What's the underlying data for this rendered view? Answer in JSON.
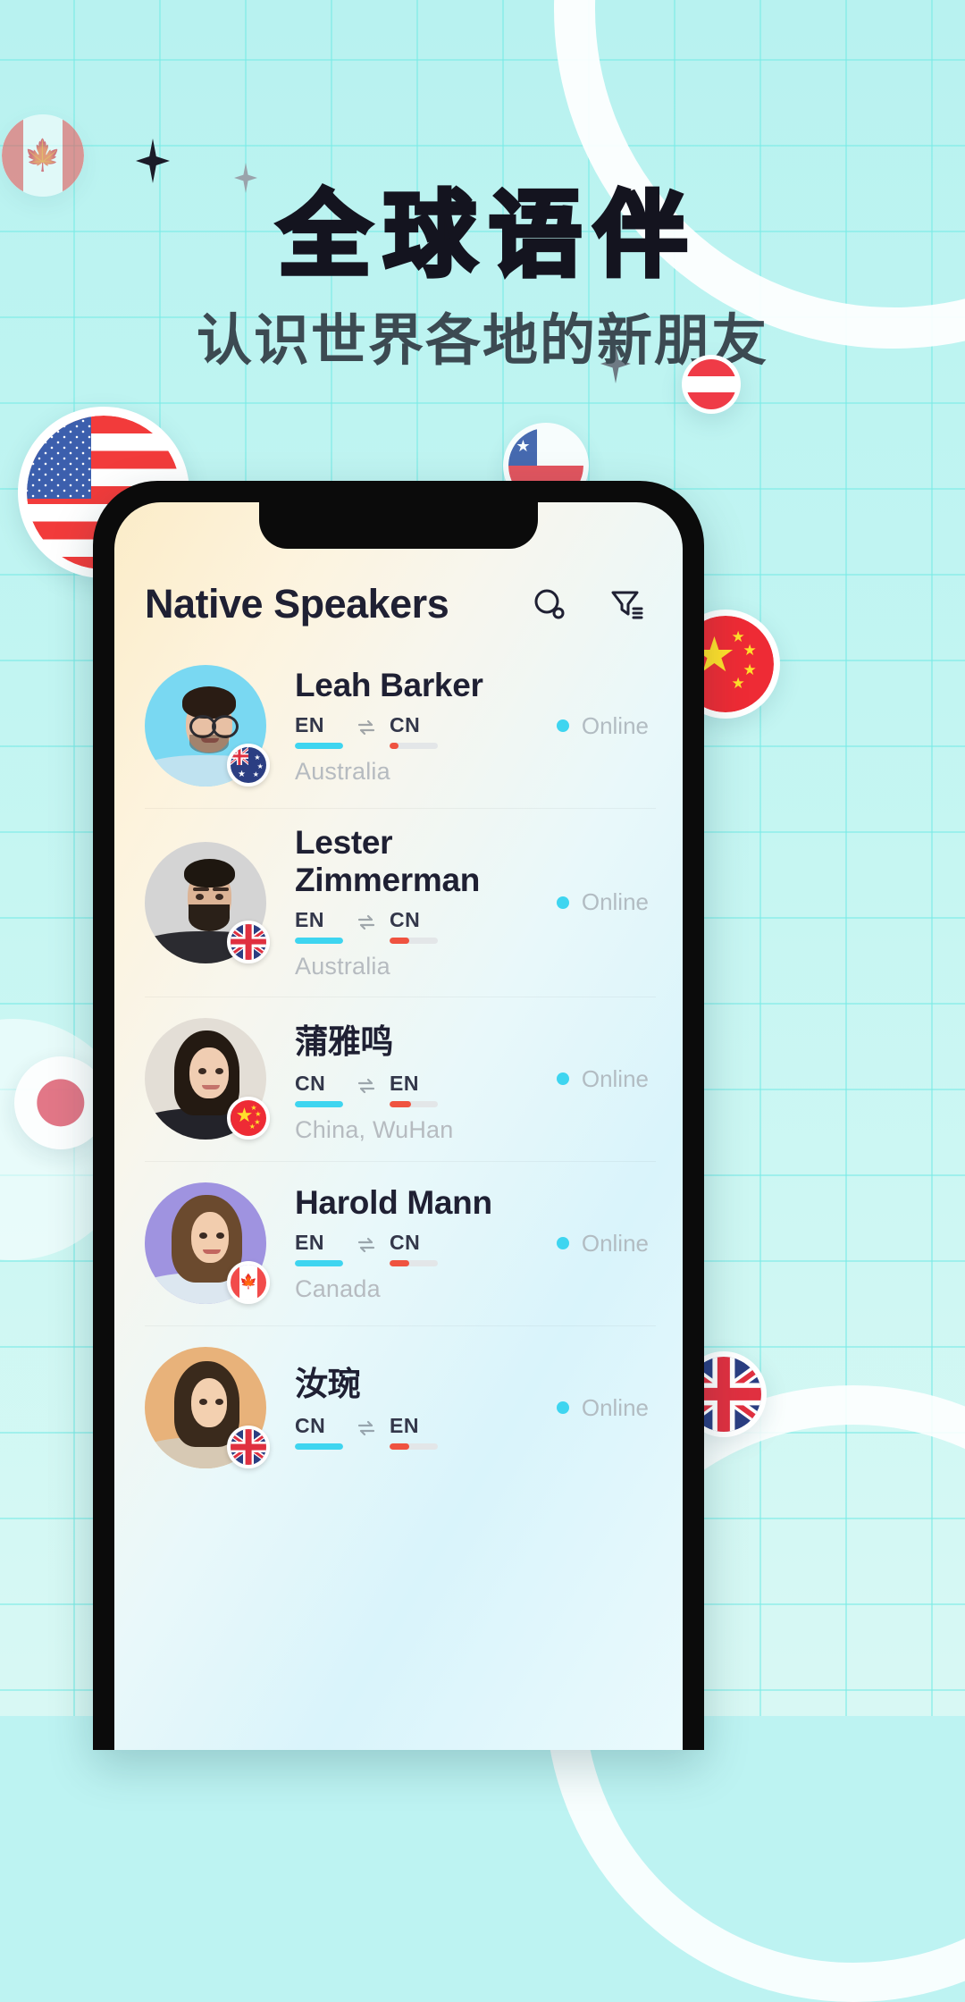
{
  "poster": {
    "headline": "全球语伴",
    "subhead": "认识世界各地的新朋友",
    "background_color": "#bdf3f2",
    "grid_color": "#78ebe6",
    "headline_color": "#14141f",
    "subhead_color": "#3c4a52"
  },
  "decor_flags": [
    {
      "name": "canada-flag-bubble",
      "code": "CA"
    },
    {
      "name": "usa-flag-bubble",
      "code": "US"
    },
    {
      "name": "austria-flag-bubble",
      "code": "AT"
    },
    {
      "name": "chile-flag-bubble",
      "code": "CL"
    },
    {
      "name": "china-flag-bubble",
      "code": "CN"
    },
    {
      "name": "japan-flag-bubble",
      "code": "JP"
    }
  ],
  "app": {
    "header": {
      "title": "Native Speakers",
      "search_icon": "search-icon",
      "filter_icon": "filter-icon"
    },
    "accent_color": "#3ed5f0",
    "status_online_label": "Online",
    "swap_icon": "swap-arrows-icon",
    "list": [
      {
        "name": "Leah Barker",
        "lang_from": "EN",
        "lang_to": "CN",
        "lang_from_level": 100,
        "lang_to_level": 18,
        "lang_from_color": "#3ed5f0",
        "lang_to_color": "#ef5340",
        "location": "Australia",
        "status": "Online",
        "flag": "AU"
      },
      {
        "name": "Lester Zimmerman",
        "lang_from": "EN",
        "lang_to": "CN",
        "lang_from_level": 100,
        "lang_to_level": 40,
        "lang_from_color": "#3ed5f0",
        "lang_to_color": "#ef5340",
        "location": "Australia",
        "status": "Online",
        "flag": "GB"
      },
      {
        "name": "蒲雅鸣",
        "lang_from": "CN",
        "lang_to": "EN",
        "lang_from_level": 100,
        "lang_to_level": 45,
        "lang_from_color": "#3ed5f0",
        "lang_to_color": "#ef5340",
        "location": "China, WuHan",
        "status": "Online",
        "flag": "CN"
      },
      {
        "name": "Harold Mann",
        "lang_from": "EN",
        "lang_to": "CN",
        "lang_from_level": 100,
        "lang_to_level": 40,
        "lang_from_color": "#3ed5f0",
        "lang_to_color": "#ef5340",
        "location": "Canada",
        "status": "Online",
        "flag": "CA"
      },
      {
        "name": "汝琬",
        "lang_from": "CN",
        "lang_to": "EN",
        "lang_from_level": 100,
        "lang_to_level": 40,
        "lang_from_color": "#3ed5f0",
        "lang_to_color": "#ef5340",
        "location": "",
        "status": "Online",
        "flag": "GB"
      }
    ]
  }
}
